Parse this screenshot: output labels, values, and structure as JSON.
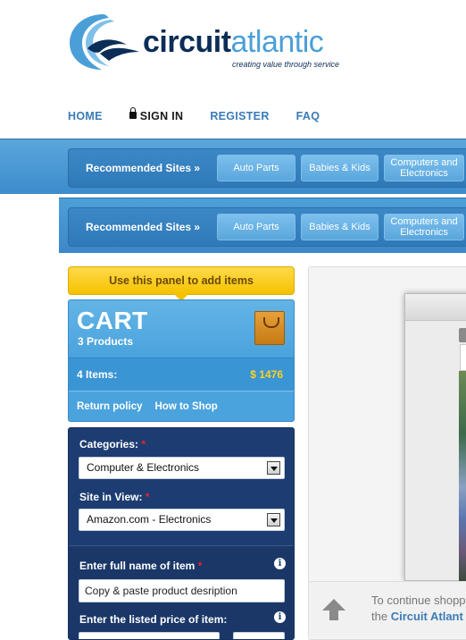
{
  "brand": {
    "name_part1": "circuit",
    "name_part2": "atlantic",
    "tagline": "creating value through service"
  },
  "topnav": {
    "home": "HOME",
    "signin": "SIGN IN",
    "register": "REGISTER",
    "faq": "FAQ"
  },
  "recommended": {
    "label": "Recommended Sites »",
    "buttons": [
      "Auto Parts",
      "Babies & Kids",
      "Computers and Electronics"
    ]
  },
  "tip": "Use this panel to add items",
  "cart": {
    "title": "CART",
    "products": "3 Products",
    "items_label": "4 Items:",
    "total": "$ 1476",
    "links": [
      "Return policy",
      "How to Shop"
    ]
  },
  "form": {
    "categories_label": "Categories:",
    "categories_value": "Computer & Electronics",
    "site_label": "Site in View:",
    "site_value": "Amazon.com - Electronics",
    "item_name_label": "Enter full name of item",
    "item_name_value": "Copy & paste product desription",
    "price_label": "Enter the listed price of item:",
    "required_mark": "*",
    "info_glyph": "i"
  },
  "preview": {
    "continue_line1": "To continue shopp",
    "continue_line2_prefix": "the ",
    "continue_line2_link": "Circuit Atlant"
  },
  "colors": {
    "brand_dark": "#0c2d57",
    "brand_light": "#4a9fd8",
    "bar_blue": "#3d8bcc",
    "tip_yellow": "#f5c200",
    "form_navy": "#1d3d72",
    "total_yellow": "#ffd21f",
    "required_red": "#e8242a"
  }
}
